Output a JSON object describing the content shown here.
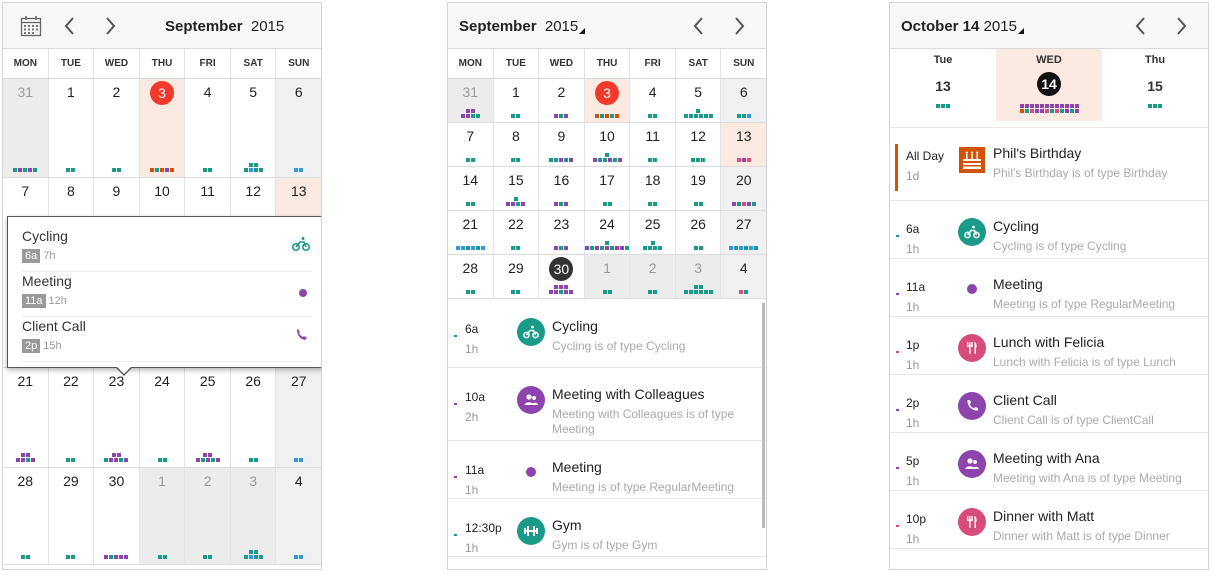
{
  "panel1": {
    "month": "September",
    "year": "2015",
    "weekdays": [
      "MON",
      "TUE",
      "WED",
      "THU",
      "FRI",
      "SAT",
      "SUN"
    ],
    "weeks": [
      [
        "31",
        "1",
        "2",
        "3",
        "4",
        "5",
        "6"
      ],
      [
        "7",
        "8",
        "9",
        "10",
        "11",
        "12",
        "13"
      ],
      [
        "21",
        "22",
        "23",
        "24",
        "25",
        "26",
        "27"
      ],
      [
        "28",
        "29",
        "30",
        "1",
        "2",
        "3",
        "4"
      ]
    ],
    "popup": [
      {
        "name": "Cycling",
        "time": "6a",
        "duration": "7h",
        "icon": "bicycle-icon"
      },
      {
        "name": "Meeting",
        "time": "11a",
        "duration": "12h",
        "icon": "meeting-dot-icon"
      },
      {
        "name": "Client Call",
        "time": "2p",
        "duration": "15h",
        "icon": "phone-icon"
      }
    ]
  },
  "panel2": {
    "month": "September",
    "year": "2015",
    "weekdays": [
      "MON",
      "TUE",
      "WED",
      "THU",
      "FRI",
      "SAT",
      "SUN"
    ],
    "weeks": [
      [
        "31",
        "1",
        "2",
        "3",
        "4",
        "5",
        "6"
      ],
      [
        "7",
        "8",
        "9",
        "10",
        "11",
        "12",
        "13"
      ],
      [
        "14",
        "15",
        "16",
        "17",
        "18",
        "19",
        "20"
      ],
      [
        "21",
        "22",
        "23",
        "24",
        "25",
        "26",
        "27"
      ],
      [
        "28",
        "29",
        "30",
        "1",
        "2",
        "3",
        "4"
      ]
    ],
    "events": [
      {
        "time": "6a",
        "duration": "1h",
        "name": "Cycling",
        "desc": "Cycling is of type Cycling",
        "icon": "bicycle-icon"
      },
      {
        "time": "10a",
        "duration": "2h",
        "name": "Meeting with Colleagues",
        "desc": "Meeting with Colleagues is of type Meeting",
        "icon": "people-icon"
      },
      {
        "time": "11a",
        "duration": "1h",
        "name": "Meeting",
        "desc": "Meeting is of type RegularMeeting",
        "icon": "meeting-dot-icon"
      },
      {
        "time": "12:30p",
        "duration": "1h",
        "name": "Gym",
        "desc": "Gym is of type Gym",
        "icon": "gym-icon"
      }
    ]
  },
  "panel3": {
    "title": "October 14",
    "year": "2015",
    "days": [
      {
        "name": "Tue",
        "num": "13"
      },
      {
        "name": "WED",
        "num": "14"
      },
      {
        "name": "Thu",
        "num": "15"
      }
    ],
    "events": [
      {
        "time": "All Day",
        "duration": "1d",
        "name": "Phil's Birthday",
        "desc": "Phil's Birthday is of type Birthday",
        "icon": "cake-icon"
      },
      {
        "time": "6a",
        "duration": "1h",
        "name": "Cycling",
        "desc": "Cycling is of type Cycling",
        "icon": "bicycle-icon"
      },
      {
        "time": "11a",
        "duration": "1h",
        "name": "Meeting",
        "desc": "Meeting is of type RegularMeeting",
        "icon": "meeting-dot-icon"
      },
      {
        "time": "1p",
        "duration": "1h",
        "name": "Lunch with Felicia",
        "desc": "Lunch with Felicia is of type Lunch",
        "icon": "fork-knife-icon"
      },
      {
        "time": "2p",
        "duration": "1h",
        "name": "Client Call",
        "desc": "Client Call is of type ClientCall",
        "icon": "phone-icon"
      },
      {
        "time": "5p",
        "duration": "1h",
        "name": "Meeting with Ana",
        "desc": "Meeting with Ana is of type Meeting",
        "icon": "people-icon"
      },
      {
        "time": "10p",
        "duration": "1h",
        "name": "Dinner with Matt",
        "desc": "Dinner with Matt is of type Dinner",
        "icon": "fork-knife-icon"
      }
    ]
  },
  "colors": {
    "teal": "#1a9a88",
    "purple": "#8e44ad",
    "pink": "#d64d7b",
    "orange": "#d35400",
    "blue": "#3498db",
    "green": "#27ae60",
    "red": "#f2392c",
    "today_bg": "#fbeae2"
  }
}
